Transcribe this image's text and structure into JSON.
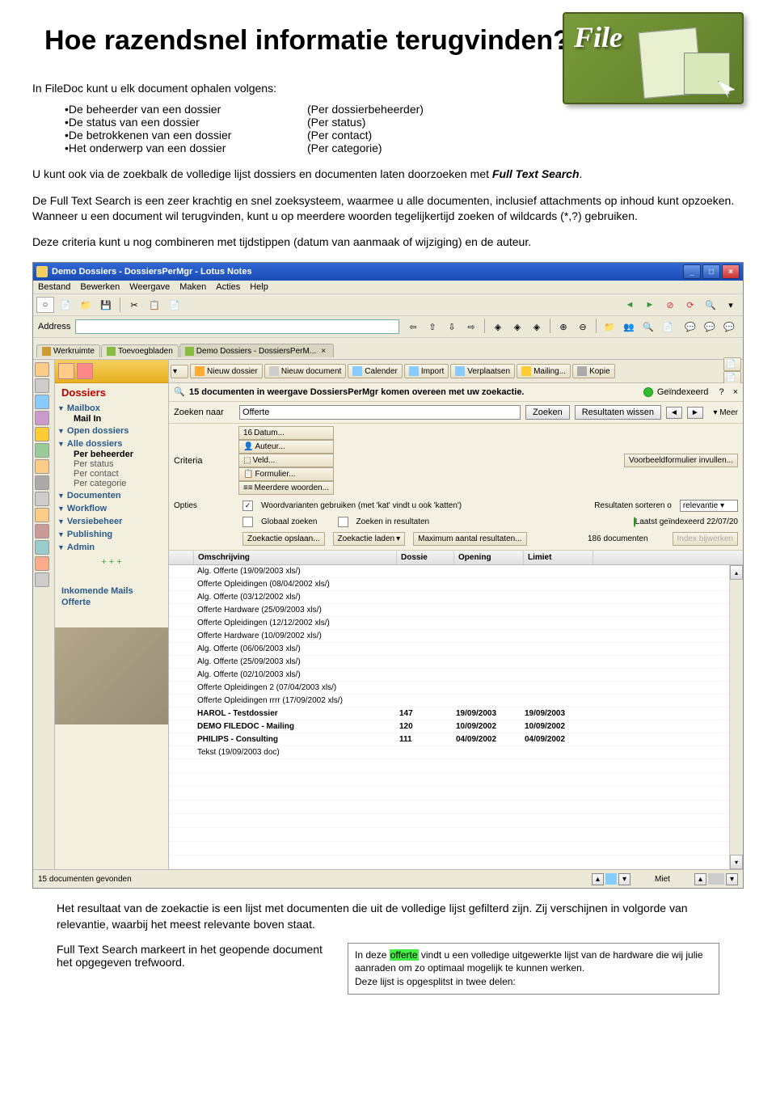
{
  "header": {
    "title": "Hoe razendsnel informatie terugvinden?",
    "logo_text": "File"
  },
  "intro": "In FileDoc kunt u elk document ophalen volgens:",
  "bullets": [
    {
      "l": "De beheerder van een dossier",
      "r": "(Per dossierbeheerder)"
    },
    {
      "l": "De status van een dossier",
      "r": "(Per status)"
    },
    {
      "l": "De betrokkenen van een dossier",
      "r": "(Per contact)"
    },
    {
      "l": "Het onderwerp van een dossier",
      "r": "(Per categorie)"
    }
  ],
  "para1_a": "U kunt ook via de zoekbalk de volledige lijst dossiers en documenten laten doorzoeken met ",
  "para1_b": "Full Text Search",
  "para1_c": ".",
  "para2": "De Full Text Search is een zeer krachtig en snel zoeksysteem, waarmee u alle documenten, inclusief attachments op inhoud kunt opzoeken. Wanneer u een document wil terugvinden, kunt u op meerdere woorden tegelijkertijd zoeken of wildcards (*,?) gebruiken.",
  "para3": "Deze criteria kunt u nog combineren met tijdstippen (datum van aanmaak of wijziging) en de auteur.",
  "app": {
    "title": "Demo Dossiers - DossiersPerMgr - Lotus Notes",
    "menu": [
      "Bestand",
      "Bewerken",
      "Weergave",
      "Maken",
      "Acties",
      "Help"
    ],
    "addr_label": "Address",
    "tabs": [
      {
        "label": "Werkruimte",
        "icon": "#c93"
      },
      {
        "label": "Toevoegbladen",
        "icon": "#8b4"
      },
      {
        "label": "Demo Dossiers - DossiersPerM...",
        "icon": "#8b4",
        "x": true,
        "active": true
      }
    ],
    "nav": {
      "title": "Dossiers",
      "sections": [
        {
          "label": "Mailbox",
          "subs": [
            "Mail In"
          ]
        },
        {
          "label": "Open dossiers"
        },
        {
          "label": "Alle dossiers",
          "subs": [
            "Per beheerder",
            "Per status",
            "Per contact",
            "Per categorie"
          ]
        },
        {
          "label": "Documenten"
        },
        {
          "label": "Workflow"
        },
        {
          "label": "Versiebeheer"
        },
        {
          "label": "Publishing"
        },
        {
          "label": "Admin"
        }
      ],
      "plus": "+ + +",
      "bottom": [
        "Inkomende Mails",
        "Offerte"
      ]
    },
    "maintb": [
      {
        "label": "Nieuw dossier",
        "icon": "#fa3"
      },
      {
        "label": "Nieuw document",
        "icon": "#ccc"
      },
      {
        "label": "Calender",
        "icon": "#8cf"
      },
      {
        "label": "Import",
        "icon": "#8cf"
      },
      {
        "label": "Verplaatsen",
        "icon": "#8cf"
      },
      {
        "label": "Mailing...",
        "icon": "#fc3"
      },
      {
        "label": "Kopie",
        "icon": "#aaa"
      }
    ],
    "search": {
      "info": "15 documenten in weergave DossiersPerMgr komen overeen met uw zoekactie.",
      "indexed": "Geïndexeerd",
      "label": "Zoeken naar",
      "value": "Offerte",
      "btn_search": "Zoeken",
      "btn_clear": "Resultaten wissen",
      "meer": "Meer",
      "crit_label": "Criteria",
      "crit": [
        "Datum...",
        "Auteur...",
        "Veld...",
        "Formulier...",
        "Meerdere woorden..."
      ],
      "crit_R": "Voorbeeldformulier invullen...",
      "opt_label": "Opties",
      "opt_variants": "Woordvarianten gebruiken (met 'kat' vindt u ook 'katten')",
      "opt_sort_lbl": "Resultaten sorteren o",
      "opt_sort_val": "relevantie",
      "opt_global": "Globaal zoeken",
      "opt_inresults": "Zoeken in resultaten",
      "opt_lastidx": "Laatst geïndexeerd  22/07/20",
      "opt_save": "Zoekactie opslaan...",
      "opt_load": "Zoekactie laden",
      "opt_max": "Maximum aantal resultaten...",
      "opt_count": "186 documenten",
      "opt_update": "Index bijwerken"
    },
    "columns": [
      "",
      "Omschrijving",
      "Dossie",
      "Opening",
      "Limiet"
    ],
    "rows": [
      {
        "d": [
          "",
          "Alg. Offerte (19/09/2003 xls/)",
          "",
          "",
          ""
        ]
      },
      {
        "d": [
          "",
          "Offerte Opleidingen (08/04/2002 xls/)",
          "",
          "",
          ""
        ]
      },
      {
        "d": [
          "",
          "Alg. Offerte (03/12/2002 xls/)",
          "",
          "",
          ""
        ]
      },
      {
        "d": [
          "",
          "Offerte Hardware (25/09/2003 xls/)",
          "",
          "",
          ""
        ]
      },
      {
        "d": [
          "",
          "Offerte Opleidingen (12/12/2002 xls/)",
          "",
          "",
          ""
        ]
      },
      {
        "d": [
          "",
          "Offerte Hardware (10/09/2002 xls/)",
          "",
          "",
          ""
        ]
      },
      {
        "d": [
          "",
          "Alg. Offerte (06/06/2003 xls/)",
          "",
          "",
          ""
        ]
      },
      {
        "d": [
          "",
          "Alg. Offerte (25/09/2003 xls/)",
          "",
          "",
          ""
        ]
      },
      {
        "d": [
          "",
          "Alg. Offerte (02/10/2003 xls/)",
          "",
          "",
          ""
        ]
      },
      {
        "d": [
          "",
          "Offerte Opleidingen 2 (07/04/2003 xls/)",
          "",
          "",
          ""
        ]
      },
      {
        "d": [
          "",
          "Offerte Opleidingen rrrr (17/09/2002 xls/)",
          "",
          "",
          ""
        ]
      },
      {
        "d": [
          "",
          "HAROL - Testdossier",
          "147",
          "19/09/2003",
          "19/09/2003"
        ],
        "b": true
      },
      {
        "d": [
          "",
          "DEMO FILEDOC - Mailing",
          "120",
          "10/09/2002",
          "10/09/2002"
        ],
        "b": true
      },
      {
        "d": [
          "",
          "PHILIPS - Consulting",
          "111",
          "04/09/2002",
          "04/09/2002"
        ],
        "b": true
      },
      {
        "d": [
          "",
          "Tekst (19/09/2003 doc)",
          "",
          "",
          ""
        ]
      }
    ],
    "status": "15 documenten gevonden",
    "status_user": "Miet"
  },
  "footer1": "Het resultaat van de zoekactie is een lijst met documenten die uit de volledige lijst gefilterd zijn. Zij verschijnen in volgorde van relevantie, waarbij het meest relevante boven staat.",
  "footer2": "Full Text Search markeert in het geopende document het opgegeven trefwoord.",
  "highlight": {
    "pre": "In deze ",
    "hl": "offerte",
    "mid": " vindt u een volledige uitgewerkte lijst van de hardware die wij julie aanraden om zo optimaal mogelijk te kunnen werken.",
    "line2": "Deze lijst is opgesplitst in twee delen:"
  }
}
